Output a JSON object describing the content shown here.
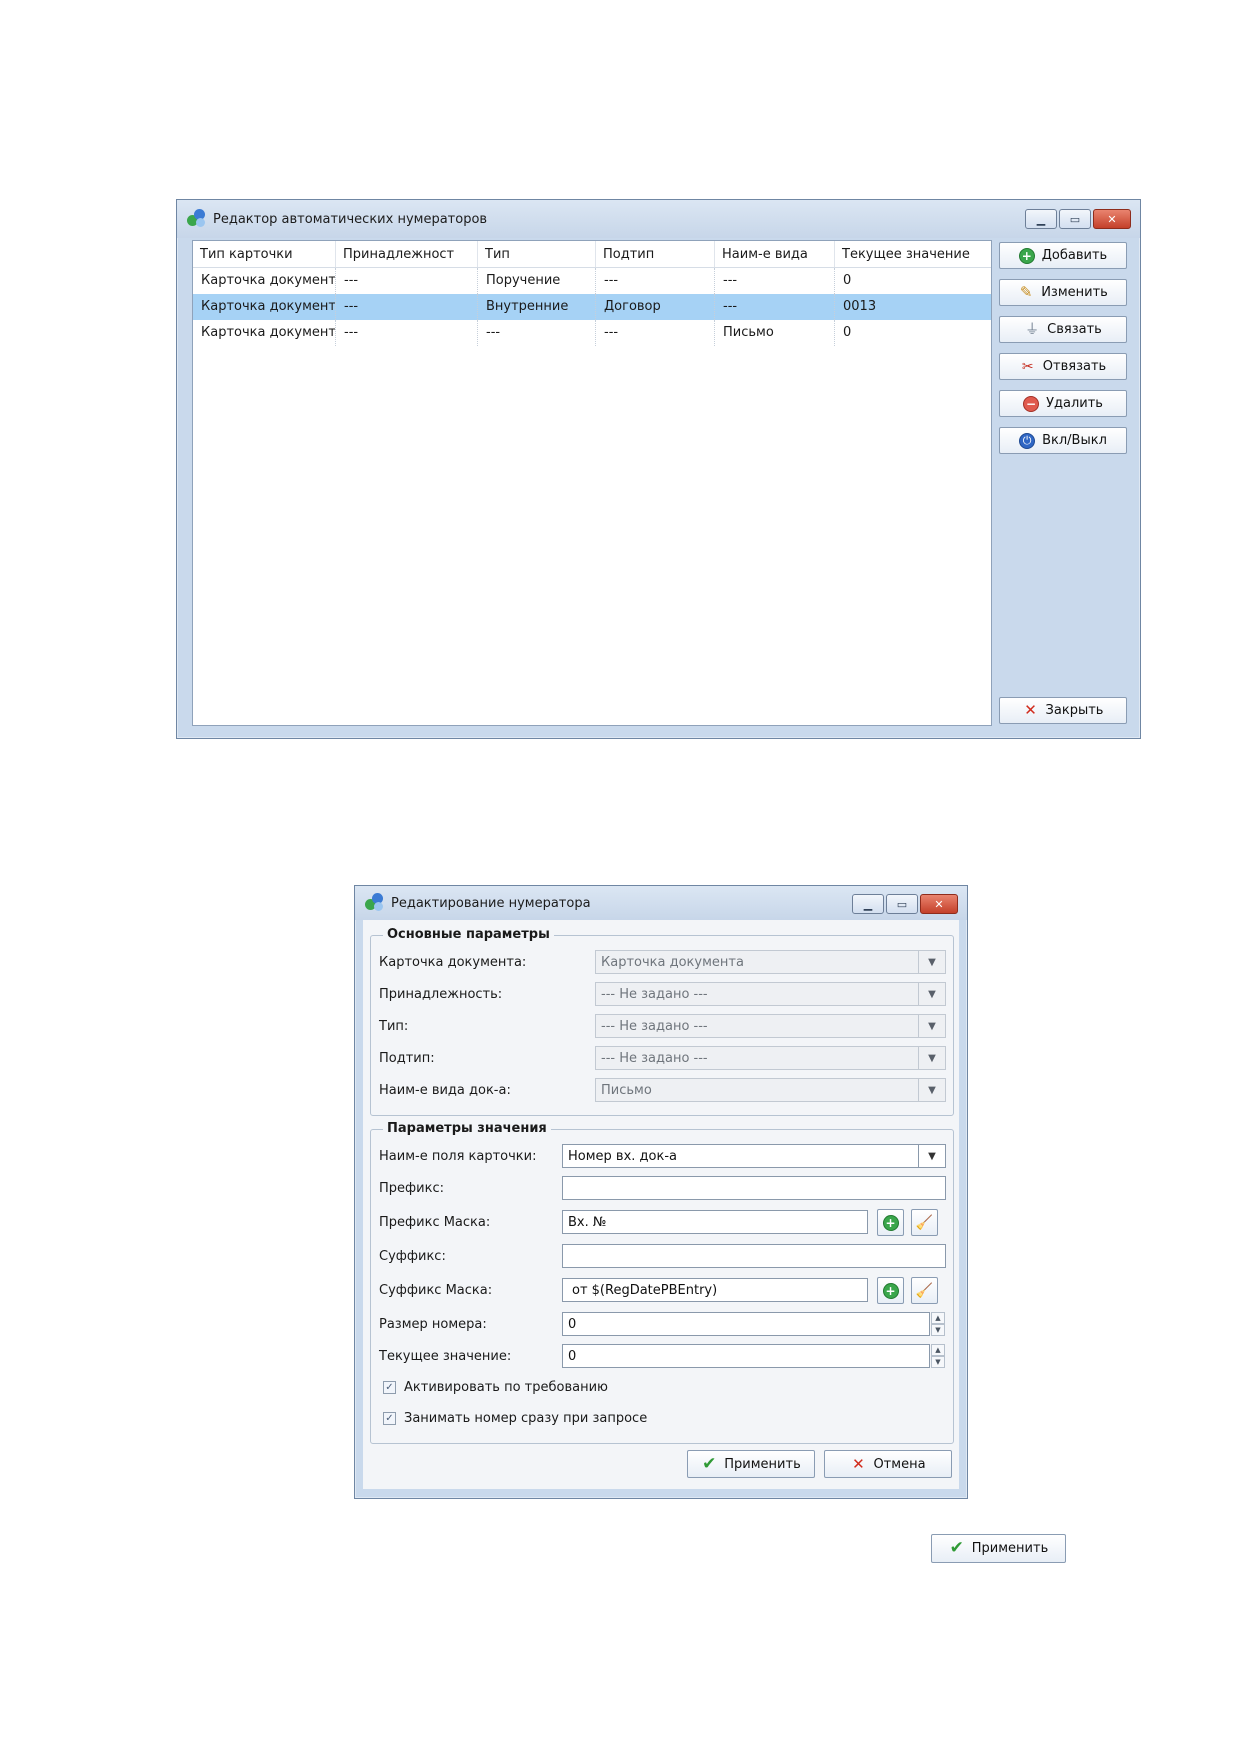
{
  "editor_window": {
    "title": "Редактор автоматических нумераторов",
    "columns": [
      "Тип карточки",
      "Принадлежност",
      "Тип",
      "Подтип",
      "Наим-е вида",
      "Текущее значение"
    ],
    "rows": [
      [
        "Карточка документа",
        "---",
        "Поручение",
        "---",
        "---",
        "0"
      ],
      [
        "Карточка документа",
        "---",
        "Внутренние",
        "Договор",
        "---",
        "0013"
      ],
      [
        "Карточка документа",
        "---",
        "---",
        "---",
        "Письмо",
        "0"
      ]
    ],
    "selected_row": 1,
    "buttons": {
      "add": "Добавить",
      "edit": "Изменить",
      "link": "Связать",
      "unlink": "Отвязать",
      "delete": "Удалить",
      "toggle": "Вкл/Выкл",
      "close": "Закрыть"
    }
  },
  "numerator_window": {
    "title": "Редактирование нумератора",
    "main_params": {
      "title": "Основные параметры",
      "doc_card_label": "Карточка документа:",
      "doc_card_value": "Карточка документа",
      "ownership_label": "Принадлежность:",
      "ownership_value": "--- Не задано ---",
      "type_label": "Тип:",
      "type_value": "--- Не задано ---",
      "subtype_label": "Подтип:",
      "subtype_value": "--- Не задано ---",
      "doc_kind_label": "Наим-е вида док-а:",
      "doc_kind_value": "Письмо"
    },
    "value_params": {
      "title": "Параметры значения",
      "field_name_label": "Наим-е поля карточки:",
      "field_name_value": "Номер вх. док-а",
      "prefix_label": "Префикс:",
      "prefix_value": "",
      "prefix_mask_label": "Префикс Маска:",
      "prefix_mask_value": "Вх. №",
      "suffix_label": "Суффикс:",
      "suffix_value": "",
      "suffix_mask_label": "Суффикс Маска:",
      "suffix_mask_value": "от $(RegDatePBEntry)",
      "number_size_label": "Размер номера:",
      "number_size_value": "0",
      "current_value_label": "Текущее значение:",
      "current_value_value": "0",
      "activate_on_demand_label": "Активировать по требованию",
      "activate_on_demand_checked": true,
      "reserve_number_label": "Занимать номер сразу при запросе",
      "reserve_number_checked": true
    },
    "apply_label": "Применить",
    "cancel_label": "Отмена"
  },
  "standalone_apply_label": "Применить",
  "icons": [
    "app-icon",
    "minimize-icon",
    "maximize-icon",
    "close-icon",
    "add-icon",
    "pencil-icon",
    "plug-icon",
    "unplug-icon",
    "delete-icon",
    "power-icon",
    "close-x-icon",
    "checkmark-icon",
    "chevron-down-icon",
    "broom-icon"
  ]
}
